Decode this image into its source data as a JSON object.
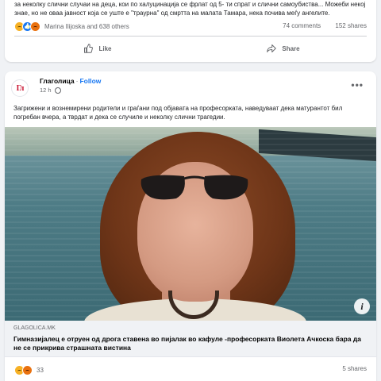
{
  "post1": {
    "text": "за неколку слични случаи на деца, кои по халуцинација се фрлат од 5- ти спрат и слични самоубиства... Можеби некој знае, но не оваа јавност која се уште е \"траурна\" од смртта на малата Тамара, нека почива меѓу ангелите.",
    "reactions_text": "Marina Ilijoska and 638 others",
    "comments": "74 comments",
    "shares": "152 shares",
    "like_label": "Like",
    "share_label": "Share"
  },
  "post2": {
    "page_name": "Глаголица",
    "follow_label": "Follow",
    "timestamp": "12 h",
    "more_icon": "•••",
    "text": "Загрижени и вознемирени родители и граѓани под објавата на професорката, наведуваат дека матурантот бил погребан вчера, а тврдат и дека се случиле и неколку слични трагедии.",
    "logo_text": "Гл",
    "link_domain": "GLAGOLICA.MK",
    "link_title": "Гимназијалец е отруен од дрога ставена во пијалак во кафуле -професорката Виолета Ачкоска бара да не се прикрива страшната вистина",
    "info_icon": "i",
    "reactions_count": "33",
    "shares": "5 shares"
  },
  "colors": {
    "accent": "#1877f2",
    "background": "#f0f2f5",
    "meta_text": "#65676b"
  }
}
